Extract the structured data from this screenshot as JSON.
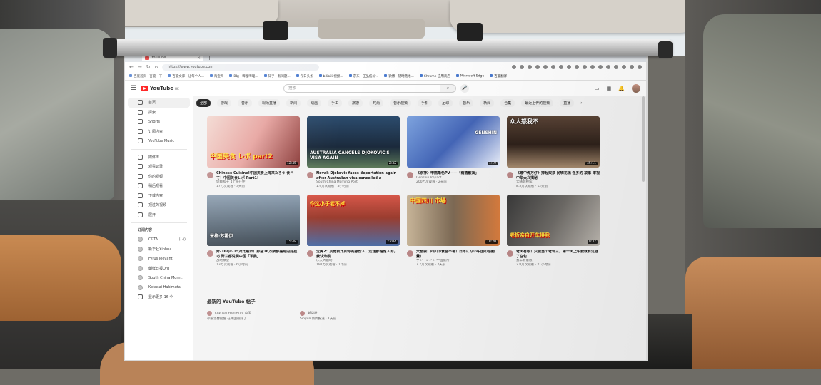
{
  "browser": {
    "tab_title": "YouTube",
    "tab_close": "×",
    "new_tab": "+",
    "url": "https://www.youtube.com",
    "bookmarks": [
      "百度首页 · 百度一下",
      "百度文库 · 让每个人...",
      "淘宝网",
      "B站 · 哔哩哔哩...",
      "知乎 · 有问题...",
      "今日头条",
      "bilibili 视频...",
      "京东 · 正品低价...",
      "微博 · 随时随地...",
      "Chrome 应用商店",
      "Microsoft Edge",
      "百度翻译"
    ]
  },
  "youtube": {
    "logo_text": "YouTube",
    "logo_region": "HK",
    "search_placeholder": "搜索",
    "search_icon": "search-icon",
    "chips": [
      "全部",
      "游戏",
      "音乐",
      "现场直播",
      "新闻",
      "动画",
      "手工",
      "旅游",
      "时尚",
      "音乐视频",
      "手机",
      "足球",
      "音乐",
      "新闻",
      "合集",
      "最近上传的视频",
      "直播"
    ],
    "sidebar": {
      "main": [
        {
          "label": "首页",
          "icon": "home-icon",
          "active": true
        },
        {
          "label": "探索",
          "icon": "compass-icon"
        },
        {
          "label": "Shorts",
          "icon": "shorts-icon"
        },
        {
          "label": "订阅内容",
          "icon": "subscriptions-icon"
        },
        {
          "label": "YouTube Music",
          "icon": "music-icon"
        }
      ],
      "library": [
        {
          "label": "媒体库",
          "icon": "library-icon"
        },
        {
          "label": "观看记录",
          "icon": "history-icon"
        },
        {
          "label": "你的视频",
          "icon": "video-icon"
        },
        {
          "label": "稍后观看",
          "icon": "clock-icon"
        },
        {
          "label": "下载内容",
          "icon": "download-icon"
        },
        {
          "label": "顶过的视频",
          "icon": "like-icon"
        },
        {
          "label": "展开",
          "icon": "chevron-down-icon"
        }
      ],
      "subs_heading": "订阅内容",
      "subs": [
        {
          "label": "CGTN",
          "live": "((·))"
        },
        {
          "label": "新华社Xinhua"
        },
        {
          "label": "Fyrus Jeevant"
        },
        {
          "label": "朝鲜日报Org"
        },
        {
          "label": "South China Morn..."
        },
        {
          "label": "Kokusai Hakimuta"
        },
        {
          "label": "显示更多 16 个"
        }
      ]
    },
    "videos": [
      {
        "title": "Chinese Cuisine!中国美食上海来たろう 食べて！中国美食レポ Part1!",
        "channel": "佐藤和子【上海在住】",
        "meta": "17万次观看 · 3天前",
        "duration": "12:45",
        "caption": "中国美食 レポ part2",
        "theme": "food"
      },
      {
        "title": "Novak Djokovic faces deportation again after Australian visa cancelled a second...",
        "channel": "South China Morning Post",
        "meta": "1.9万次观看 · 5小时前",
        "duration": "2:32",
        "caption": "AUSTRALIA CANCELS DJOKOVIC'S VISA AGAIN",
        "theme": "tennis"
      },
      {
        "title": "《原神》申鹤角色PV——「雨落散淡」",
        "channel": "Genshin Impact",
        "meta": "200万次观看 · 2天前",
        "duration": "1:19",
        "caption": "GENSHIN",
        "theme": "genshin"
      },
      {
        "title": "《雍中传万仔》捧起双泉 民嗨花隔 强多的 故事 审视中华大义揭秘",
        "channel": "大陆影视馆",
        "meta": "8.5万次观看 · 12天前",
        "duration": "45:11",
        "caption": "众人怒我不",
        "theme": "drama"
      },
      {
        "title": "歼-16与F-15对比展示！那些16万架都差距的好技巧 歼三都说明中国「军委」",
        "channel": "战地瞭望",
        "meta": "13万次观看 · 6小时前",
        "duration": "15:48",
        "caption": "米格·苏霍伊",
        "theme": "jet"
      },
      {
        "title": "沈腾2：其他就比如你的身份人，这话都语惊人的，我认为很...",
        "channel": "乐天大剧场",
        "meta": "197万次观看 · 1年前",
        "duration": "22:04",
        "caption": "你这小子老不掉",
        "theme": "show"
      },
      {
        "title": "大都会！四川の食堂市場！日本にない中国の感動量！",
        "channel": "サン・ミノン 中国旅行",
        "meta": "7.7万次观看 · 7天前",
        "duration": "18:20",
        "caption": "中国四川 市場",
        "theme": "market"
      },
      {
        "title": "老天有眼！只能当个老玩三，第一天上午我就有过挂了在包",
        "channel": "赛车有意思",
        "meta": "2.8万次观看 · 21小时前",
        "duration": "9:37",
        "caption": "老板亲自开车接我",
        "theme": "car"
      }
    ],
    "shorts_heading": "最新的 YouTube 帖子",
    "posts": [
      {
        "channel": "Kokusai Hakimuta 中国",
        "text": "小编温馨提醒 在中国最好了..."
      },
      {
        "channel": "新华社",
        "text": "Sinyun 新闻报道 · 1天前"
      }
    ],
    "colors": {
      "brand": "#ff0000",
      "chip_active": "#111111"
    }
  }
}
